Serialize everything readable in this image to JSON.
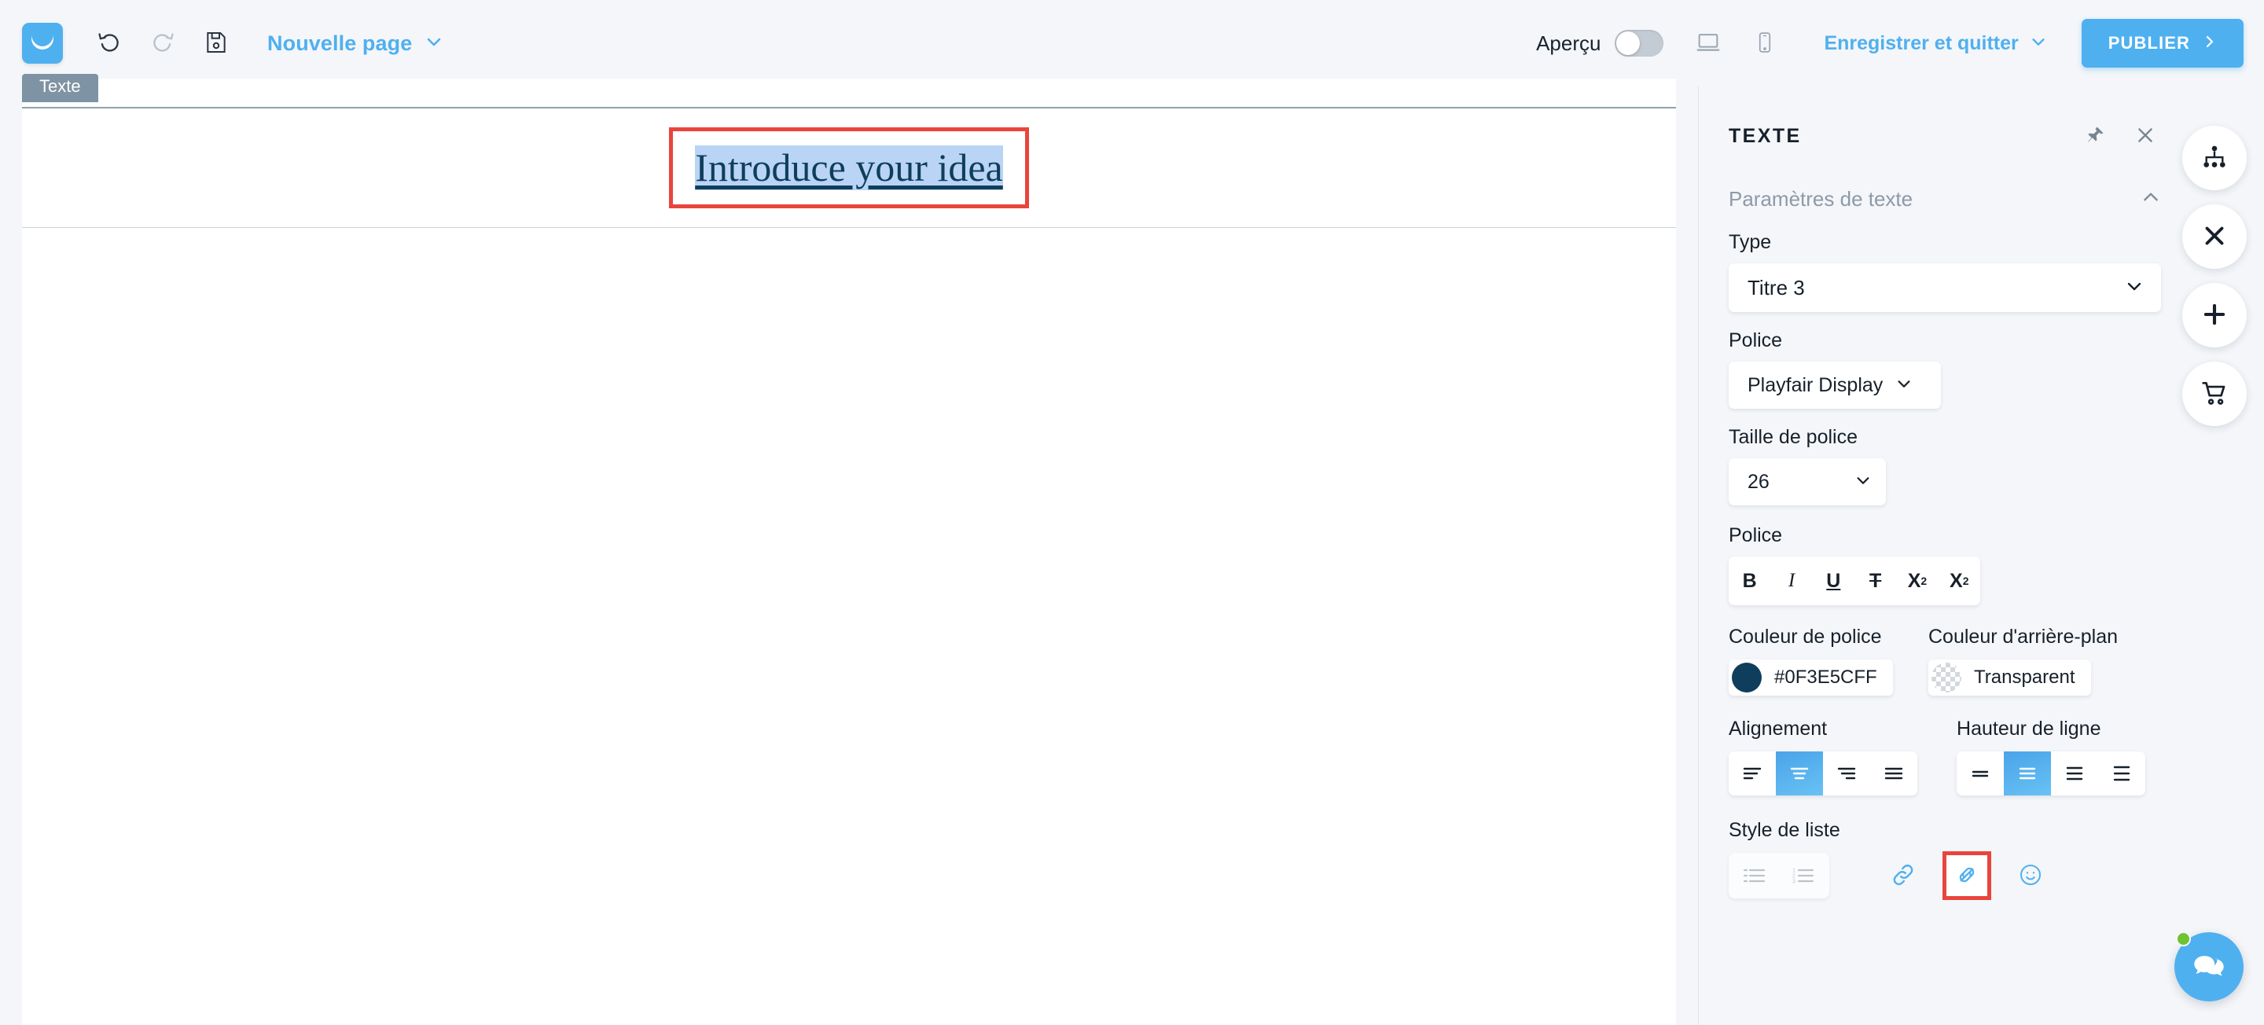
{
  "topbar": {
    "logo_icon": "envelope-logo-icon",
    "undo_icon": "undo-icon",
    "redo_icon": "redo-icon",
    "save_icon": "save-disk-icon",
    "page_selector_label": "Nouvelle page",
    "page_selector_chevron": "chevron-down-icon",
    "preview_label": "Aperçu",
    "preview_toggle_state": "off",
    "desktop_icon": "laptop-icon",
    "mobile_icon": "mobile-phone-icon",
    "save_and_quit_label": "Enregistrer et quitter",
    "save_and_quit_chevron": "chevron-down-icon",
    "publish_label": "PUBLIER",
    "publish_arrow": "chevron-right-icon",
    "accent_color": "#4FB0F0"
  },
  "canvas": {
    "section_tab_label": "Texte",
    "selected_text": "Introduce your idea",
    "selected_text_color": "#0F3E5C",
    "selection_highlight_color": "#B9D4F5",
    "annotation_box_color": "#E8453C"
  },
  "panel": {
    "title": "TEXTE",
    "pin_icon": "pin-icon",
    "close_icon": "close-icon",
    "settings_section_label": "Paramètres de texte",
    "settings_collapse_icon": "chevron-up-icon",
    "type": {
      "label": "Type",
      "value": "Titre 3",
      "chevron": "chevron-down-icon"
    },
    "font": {
      "label": "Police",
      "value": "Playfair Display",
      "chevron": "chevron-down-icon"
    },
    "font_size": {
      "label": "Taille de police",
      "value": "26",
      "chevron": "chevron-down-icon"
    },
    "style": {
      "label": "Police",
      "buttons": [
        {
          "name": "bold-button",
          "label": "B"
        },
        {
          "name": "italic-button",
          "label": "I"
        },
        {
          "name": "underline-button",
          "label": "U"
        },
        {
          "name": "strikethrough-button",
          "label": "T"
        },
        {
          "name": "subscript-button",
          "label": "X"
        },
        {
          "name": "superscript-button",
          "label": "X"
        }
      ]
    },
    "font_color": {
      "label": "Couleur de police",
      "value": "#0F3E5CFF",
      "swatch": "#0F3E5C"
    },
    "background_color": {
      "label": "Couleur d'arrière-plan",
      "value": "Transparent",
      "swatch": "transparent"
    },
    "alignment": {
      "label": "Alignement",
      "options": [
        "align-left",
        "align-center",
        "align-right",
        "align-justify"
      ],
      "active_index": 1
    },
    "line_height": {
      "label": "Hauteur de ligne",
      "options": [
        "line-height-1",
        "line-height-2",
        "line-height-3",
        "line-height-4"
      ],
      "active_index": 1
    },
    "list_style": {
      "label": "Style de liste",
      "buttons": [
        {
          "name": "bulleted-list-button",
          "disabled": true
        },
        {
          "name": "numbered-list-button",
          "disabled": true
        }
      ],
      "link_buttons": [
        {
          "name": "insert-link-button",
          "highlighted": false
        },
        {
          "name": "remove-link-button",
          "highlighted": true
        },
        {
          "name": "emoji-button",
          "highlighted": false
        }
      ]
    }
  },
  "rail": {
    "buttons": [
      {
        "name": "sitemap-button",
        "icon": "sitemap-icon"
      },
      {
        "name": "close-editor-button",
        "icon": "close-x-icon"
      },
      {
        "name": "add-element-button",
        "icon": "plus-icon"
      },
      {
        "name": "cart-button",
        "icon": "shopping-cart-icon"
      }
    ]
  },
  "chat": {
    "name": "chat-support-button",
    "icon": "chat-bubbles-icon",
    "status": "online",
    "color": "#4FB0F0",
    "status_color": "#6FC230"
  }
}
